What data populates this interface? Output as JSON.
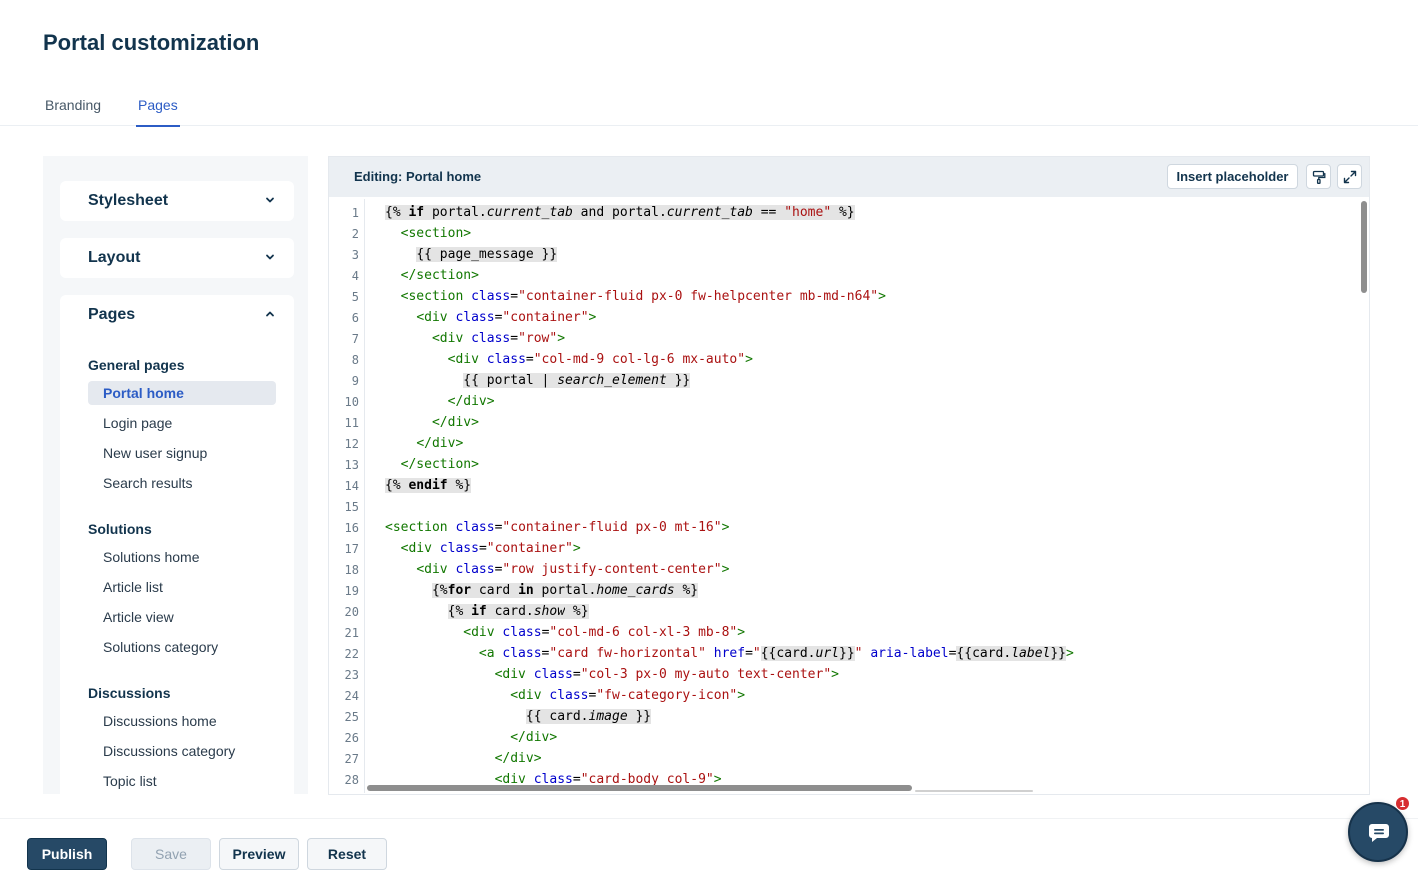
{
  "header": {
    "title": "Portal customization"
  },
  "tabs": [
    {
      "label": "Branding",
      "active": false
    },
    {
      "label": "Pages",
      "active": true
    }
  ],
  "sidebar": {
    "sections": [
      {
        "title": "Stylesheet",
        "expanded": false,
        "chevron": "chevron-down-icon"
      },
      {
        "title": "Layout",
        "expanded": false,
        "chevron": "chevron-down-icon"
      },
      {
        "title": "Pages",
        "expanded": true,
        "chevron": "chevron-up-icon"
      }
    ],
    "groups": [
      {
        "title": "General pages",
        "items": [
          "Portal home",
          "Login page",
          "New user signup",
          "Search results"
        ]
      },
      {
        "title": "Solutions",
        "items": [
          "Solutions home",
          "Article list",
          "Article view",
          "Solutions category"
        ]
      },
      {
        "title": "Discussions",
        "items": [
          "Discussions home",
          "Discussions category",
          "Topic list"
        ]
      }
    ],
    "active_item": "Portal home"
  },
  "editor": {
    "title": "Editing: Portal home",
    "insert_label": "Insert placeholder",
    "icons": [
      "paint-format-icon",
      "expand-icon"
    ],
    "lines": [
      [
        [
          "tpl",
          "{% "
        ],
        [
          "tpl kw",
          "if"
        ],
        [
          "tpl",
          " portal."
        ],
        [
          "tpl var",
          "current_tab"
        ],
        [
          "tpl",
          " and portal."
        ],
        [
          "tpl var",
          "current_tab"
        ],
        [
          "tpl",
          " == "
        ],
        [
          "tpl str",
          "\"home\""
        ],
        [
          "tpl",
          " %}"
        ]
      ],
      [
        [
          "",
          "  "
        ],
        [
          "tag",
          "<section>"
        ]
      ],
      [
        [
          "",
          "    "
        ],
        [
          "tpl",
          "{{ page_message }}"
        ]
      ],
      [
        [
          "",
          "  "
        ],
        [
          "tag",
          "</section>"
        ]
      ],
      [
        [
          "",
          "  "
        ],
        [
          "tag",
          "<section "
        ],
        [
          "attr",
          "class"
        ],
        [
          "",
          "="
        ],
        [
          "str",
          "\"container-fluid px-0 fw-helpcenter mb-md-n64\""
        ],
        [
          "tag",
          ">"
        ]
      ],
      [
        [
          "",
          "    "
        ],
        [
          "tag",
          "<div "
        ],
        [
          "attr",
          "class"
        ],
        [
          "",
          "="
        ],
        [
          "str",
          "\"container\""
        ],
        [
          "tag",
          ">"
        ]
      ],
      [
        [
          "",
          "      "
        ],
        [
          "tag",
          "<div "
        ],
        [
          "attr",
          "class"
        ],
        [
          "",
          "="
        ],
        [
          "str",
          "\"row\""
        ],
        [
          "tag",
          ">"
        ]
      ],
      [
        [
          "",
          "        "
        ],
        [
          "tag",
          "<div "
        ],
        [
          "attr",
          "class"
        ],
        [
          "",
          "="
        ],
        [
          "str",
          "\"col-md-9 col-lg-6 mx-auto\""
        ],
        [
          "tag",
          ">"
        ]
      ],
      [
        [
          "",
          "          "
        ],
        [
          "tpl",
          "{{ portal | "
        ],
        [
          "tpl var",
          "search_element"
        ],
        [
          "tpl",
          " }}"
        ]
      ],
      [
        [
          "",
          "        "
        ],
        [
          "tag",
          "</div>"
        ]
      ],
      [
        [
          "",
          "      "
        ],
        [
          "tag",
          "</div>"
        ]
      ],
      [
        [
          "",
          "    "
        ],
        [
          "tag",
          "</div>"
        ]
      ],
      [
        [
          "",
          "  "
        ],
        [
          "tag",
          "</section>"
        ]
      ],
      [
        [
          "tpl",
          "{% "
        ],
        [
          "tpl kw",
          "endif"
        ],
        [
          "tpl",
          " %}"
        ]
      ],
      [],
      [
        [
          "tag",
          "<section "
        ],
        [
          "attr",
          "class"
        ],
        [
          "",
          "="
        ],
        [
          "str",
          "\"container-fluid px-0 mt-16\""
        ],
        [
          "tag",
          ">"
        ]
      ],
      [
        [
          "",
          "  "
        ],
        [
          "tag",
          "<div "
        ],
        [
          "attr",
          "class"
        ],
        [
          "",
          "="
        ],
        [
          "str",
          "\"container\""
        ],
        [
          "tag",
          ">"
        ]
      ],
      [
        [
          "",
          "    "
        ],
        [
          "tag",
          "<div "
        ],
        [
          "attr",
          "class"
        ],
        [
          "",
          "="
        ],
        [
          "str",
          "\"row justify-content-center\""
        ],
        [
          "tag",
          ">"
        ]
      ],
      [
        [
          "",
          "      "
        ],
        [
          "tpl",
          "{%"
        ],
        [
          "tpl kw",
          "for"
        ],
        [
          "tpl",
          " card "
        ],
        [
          "tpl kw",
          "in"
        ],
        [
          "tpl",
          " portal."
        ],
        [
          "tpl var",
          "home_cards"
        ],
        [
          "tpl",
          " %}"
        ]
      ],
      [
        [
          "",
          "        "
        ],
        [
          "tpl",
          "{% "
        ],
        [
          "tpl kw",
          "if"
        ],
        [
          "tpl",
          " card."
        ],
        [
          "tpl var",
          "show"
        ],
        [
          "tpl",
          " %}"
        ]
      ],
      [
        [
          "",
          "          "
        ],
        [
          "tag",
          "<div "
        ],
        [
          "attr",
          "class"
        ],
        [
          "",
          "="
        ],
        [
          "str",
          "\"col-md-6 col-xl-3 mb-8\""
        ],
        [
          "tag",
          ">"
        ]
      ],
      [
        [
          "",
          "            "
        ],
        [
          "tag",
          "<a "
        ],
        [
          "attr",
          "class"
        ],
        [
          "",
          "="
        ],
        [
          "str",
          "\"card fw-horizontal\" "
        ],
        [
          "attr",
          "href"
        ],
        [
          "",
          "="
        ],
        [
          "str",
          "\""
        ],
        [
          "tpl",
          "{{card."
        ],
        [
          "tpl var",
          "url"
        ],
        [
          "tpl",
          "}}"
        ],
        [
          "str",
          "\" "
        ],
        [
          "attr",
          "aria-label"
        ],
        [
          "",
          "="
        ],
        [
          "tpl",
          "{{card."
        ],
        [
          "tpl var",
          "label"
        ],
        [
          "tpl",
          "}}"
        ],
        [
          "tag",
          ">"
        ]
      ],
      [
        [
          "",
          "              "
        ],
        [
          "tag",
          "<div "
        ],
        [
          "attr",
          "class"
        ],
        [
          "",
          "="
        ],
        [
          "str",
          "\"col-3 px-0 my-auto text-center\""
        ],
        [
          "tag",
          ">"
        ]
      ],
      [
        [
          "",
          "                "
        ],
        [
          "tag",
          "<div "
        ],
        [
          "attr",
          "class"
        ],
        [
          "",
          "="
        ],
        [
          "str",
          "\"fw-category-icon\""
        ],
        [
          "tag",
          ">"
        ]
      ],
      [
        [
          "",
          "                  "
        ],
        [
          "tpl",
          "{{ card."
        ],
        [
          "tpl var",
          "image"
        ],
        [
          "tpl",
          " }}"
        ]
      ],
      [
        [
          "",
          "                "
        ],
        [
          "tag",
          "</div>"
        ]
      ],
      [
        [
          "",
          "              "
        ],
        [
          "tag",
          "</div>"
        ]
      ],
      [
        [
          "",
          "              "
        ],
        [
          "tag",
          "<div "
        ],
        [
          "attr",
          "class"
        ],
        [
          "",
          "="
        ],
        [
          "str",
          "\"card-body col-9\""
        ],
        [
          "tag",
          ">"
        ]
      ]
    ]
  },
  "footer": {
    "publish_label": "Publish",
    "save_label": "Save",
    "preview_label": "Preview",
    "reset_label": "Reset"
  },
  "chat": {
    "badge_count": "1",
    "icon": "chat-icon"
  }
}
